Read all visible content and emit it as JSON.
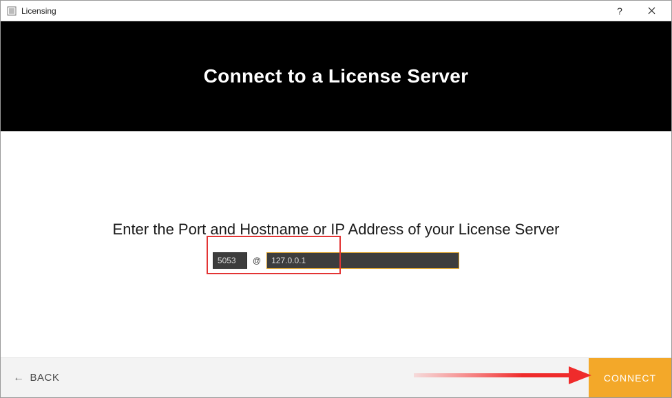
{
  "window": {
    "title": "Licensing"
  },
  "header": {
    "title": "Connect to a License Server"
  },
  "body": {
    "instruction": "Enter the Port and Hostname or IP Address of your License Server",
    "port_value": "5053",
    "at_label": "@",
    "host_value": "127.0.0.1"
  },
  "footer": {
    "back_label": "BACK",
    "connect_label": "CONNECT"
  }
}
